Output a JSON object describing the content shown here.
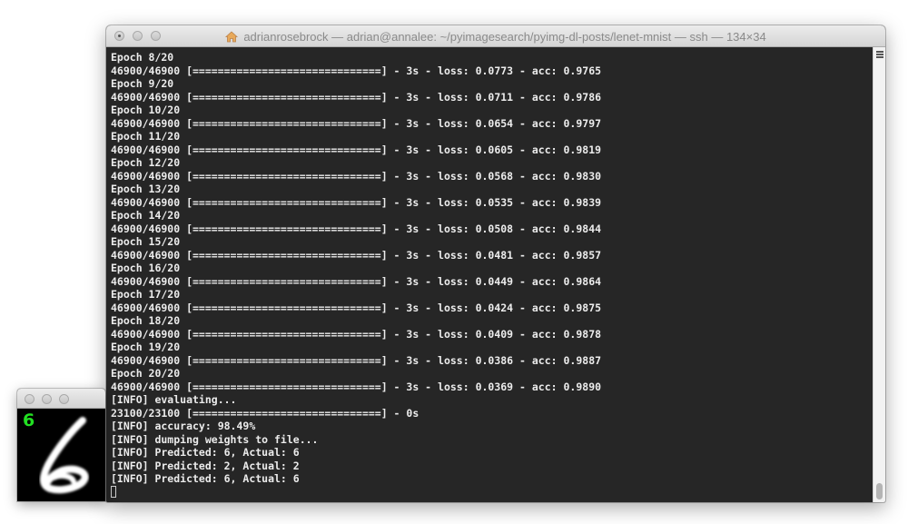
{
  "window": {
    "title": "adrianrosebrock — adrian@annalee: ~/pyimagesearch/pyimg-dl-posts/lenet-mnist — ssh — 134×34"
  },
  "terminal": {
    "lines": [
      "Epoch 8/20",
      "46900/46900 [==============================] - 3s - loss: 0.0773 - acc: 0.9765",
      "Epoch 9/20",
      "46900/46900 [==============================] - 3s - loss: 0.0711 - acc: 0.9786",
      "Epoch 10/20",
      "46900/46900 [==============================] - 3s - loss: 0.0654 - acc: 0.9797",
      "Epoch 11/20",
      "46900/46900 [==============================] - 3s - loss: 0.0605 - acc: 0.9819",
      "Epoch 12/20",
      "46900/46900 [==============================] - 3s - loss: 0.0568 - acc: 0.9830",
      "Epoch 13/20",
      "46900/46900 [==============================] - 3s - loss: 0.0535 - acc: 0.9839",
      "Epoch 14/20",
      "46900/46900 [==============================] - 3s - loss: 0.0508 - acc: 0.9844",
      "Epoch 15/20",
      "46900/46900 [==============================] - 3s - loss: 0.0481 - acc: 0.9857",
      "Epoch 16/20",
      "46900/46900 [==============================] - 3s - loss: 0.0449 - acc: 0.9864",
      "Epoch 17/20",
      "46900/46900 [==============================] - 3s - loss: 0.0424 - acc: 0.9875",
      "Epoch 18/20",
      "46900/46900 [==============================] - 3s - loss: 0.0409 - acc: 0.9878",
      "Epoch 19/20",
      "46900/46900 [==============================] - 3s - loss: 0.0386 - acc: 0.9887",
      "Epoch 20/20",
      "46900/46900 [==============================] - 3s - loss: 0.0369 - acc: 0.9890",
      "[INFO] evaluating...",
      "23100/23100 [==============================] - 0s",
      "[INFO] accuracy: 98.49%",
      "[INFO] dumping weights to file...",
      "[INFO] Predicted: 6, Actual: 6",
      "[INFO] Predicted: 2, Actual: 2",
      "[INFO] Predicted: 6, Actual: 6"
    ]
  },
  "digit_window": {
    "predicted_label": "6"
  },
  "colors": {
    "terminal_bg": "#262626",
    "terminal_text": "#ececec",
    "prediction_green": "#22e022"
  }
}
